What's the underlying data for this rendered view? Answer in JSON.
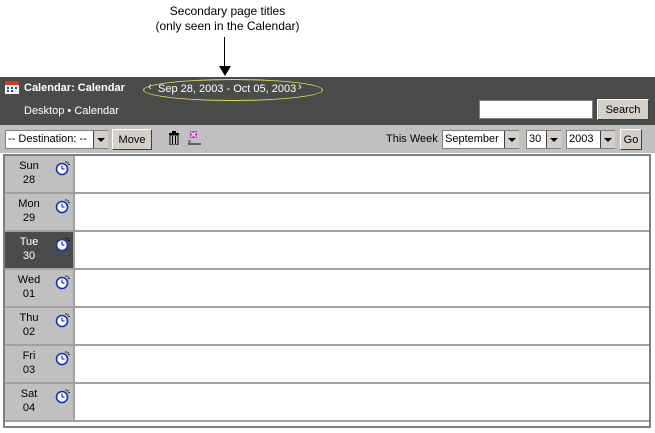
{
  "annotation": {
    "line1": "Secondary page titles",
    "line2": "(only seen in the Calendar)"
  },
  "header": {
    "title": "Calendar: Calendar",
    "range": "Sep 28, 2003 - Oct 05, 2003",
    "breadcrumb": "Desktop • Calendar",
    "search_value": "",
    "search_label": "Search"
  },
  "toolbar": {
    "destination": "-- Destination: --",
    "move_label": "Move",
    "this_week": "This Week",
    "month": "September",
    "day": "30",
    "year": "2003",
    "go_label": "Go"
  },
  "days": [
    {
      "name": "Sun",
      "num": "28"
    },
    {
      "name": "Mon",
      "num": "29"
    },
    {
      "name": "Tue",
      "num": "30"
    },
    {
      "name": "Wed",
      "num": "01"
    },
    {
      "name": "Thu",
      "num": "02"
    },
    {
      "name": "Fri",
      "num": "03"
    },
    {
      "name": "Sat",
      "num": "04"
    }
  ],
  "colors": {
    "header_bg": "#4a4c4a",
    "toolbar_bg": "#c0c0c0",
    "highlight_ring": "#e8e04a",
    "today_bg": "#4a4c4a"
  }
}
